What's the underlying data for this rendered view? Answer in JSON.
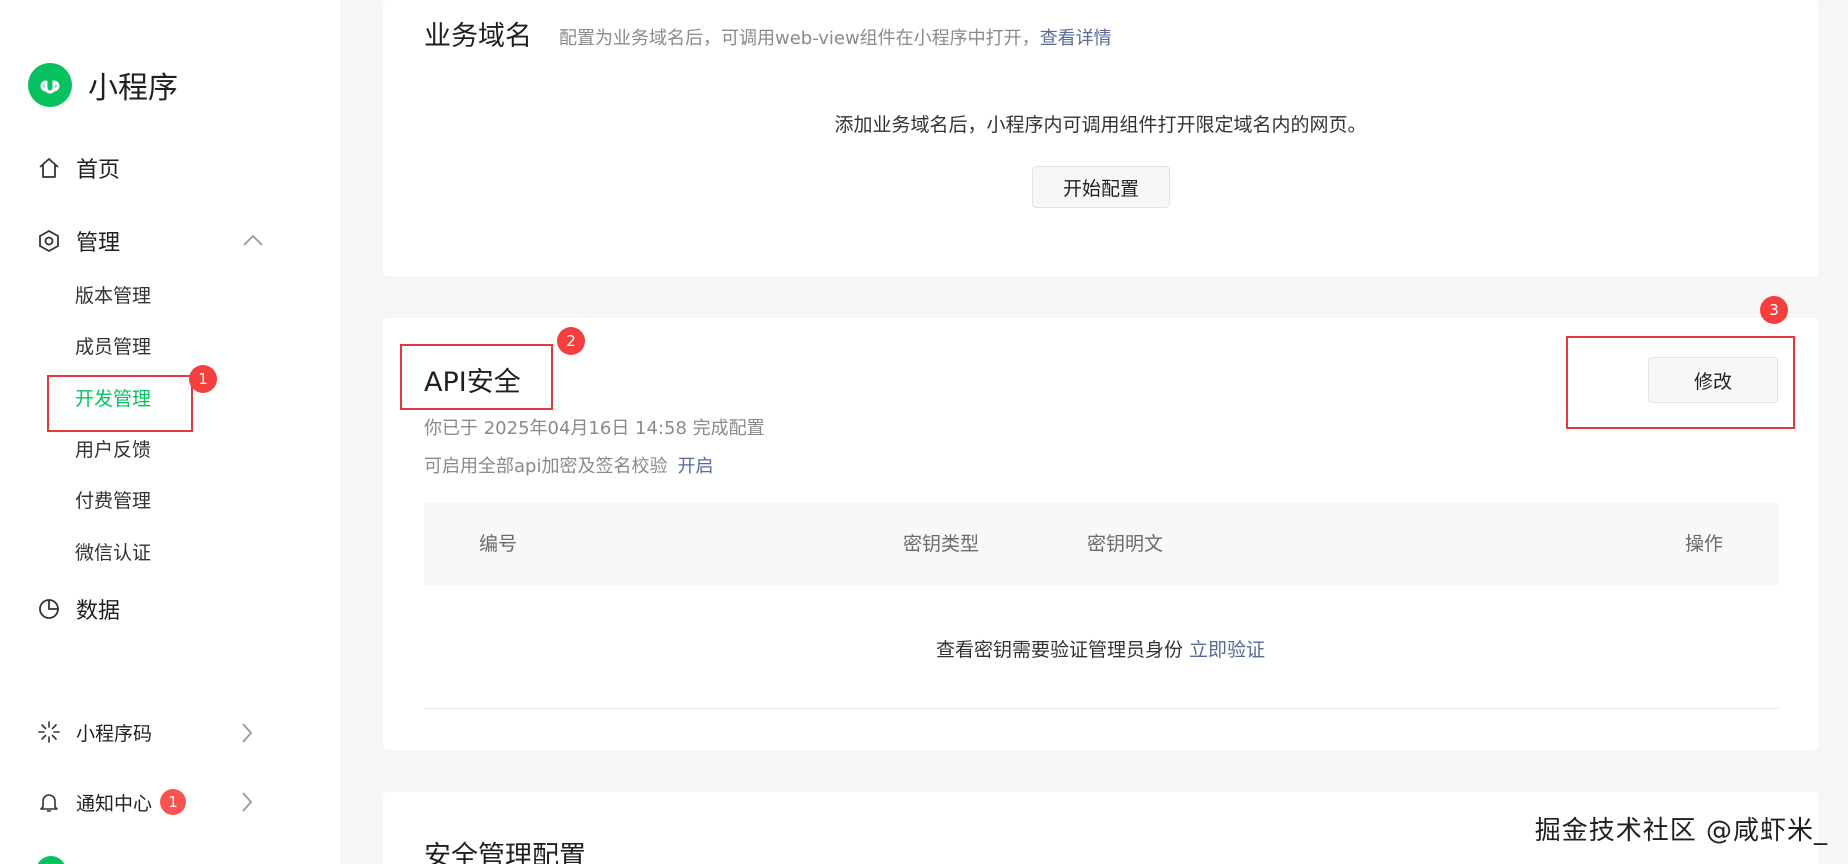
{
  "sidebar": {
    "brand": "小程序",
    "nav": {
      "home": "首页",
      "manage": "管理",
      "data": "数据",
      "qrcode": "小程序码",
      "notice": "通知中心",
      "notice_badge": "1"
    },
    "manage_items": [
      "版本管理",
      "成员管理",
      "开发管理",
      "用户反馈",
      "付费管理",
      "微信认证"
    ]
  },
  "annotations": [
    "1",
    "2",
    "3"
  ],
  "business_domain": {
    "title": "业务域名",
    "desc": "配置为业务域名后，可调用web-view组件在小程序中打开，",
    "desc_link": "查看详情",
    "body": "添加业务域名后，小程序内可调用组件打开限定域名内的网页。",
    "button": "开始配置"
  },
  "api_security": {
    "title": "API安全",
    "configured": "你已于 2025年04月16日 14:58 完成配置",
    "hint": "可启用全部api加密及签名校验",
    "hint_link": "开启",
    "modify_button": "修改",
    "table_headers": [
      "编号",
      "密钥类型",
      "密钥明文",
      "操作"
    ],
    "verify_text": "查看密钥需要验证管理员身份",
    "verify_link": "立即验证"
  },
  "security_config": {
    "title": "安全管理配置"
  },
  "watermark": "掘金技术社区 @咸虾米_",
  "colors": {
    "accent": "#07c160",
    "link": "#576b95",
    "annotation": "#e0393e"
  }
}
